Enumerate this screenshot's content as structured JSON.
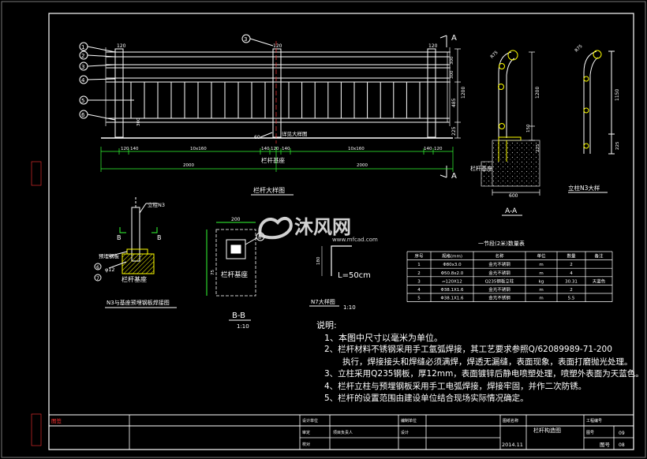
{
  "balloons": [
    "1",
    "2",
    "3",
    "4",
    "5",
    "6"
  ],
  "elevation": {
    "title": "栏杆大样图",
    "section_mark": "A",
    "see_detail_text": "详见大样图",
    "base_text": "栏杆基座",
    "post_top": "120",
    "dim_top_row": [
      "120",
      "140",
      "10x160",
      "140",
      "120",
      "140",
      "10x160",
      "140",
      "120"
    ],
    "dim_bottom": [
      "2000",
      "2000"
    ],
    "heights": [
      "1200",
      "485",
      "225",
      "60",
      "300",
      "300",
      "300"
    ]
  },
  "section_aa": {
    "title": "A-A",
    "base_label": "栏杆基座",
    "width": "600",
    "radius_label": "R75",
    "heights": [
      "1200",
      "150",
      "225"
    ]
  },
  "post_detail": {
    "title": "立柱N3大样",
    "radius_label": "R75",
    "heights": [
      "1150",
      "225"
    ]
  },
  "embed_detail": {
    "title": "N3与基座预埋钢板焊接图",
    "post_label": "立柱N3",
    "plate_label": "预埋钢板",
    "bolt_label": "φ12",
    "base_label": "栏杆基座",
    "marks": [
      "B",
      "B",
      "6",
      "7"
    ]
  },
  "section_bb": {
    "title": "B-B",
    "scale": "1:10",
    "label": "栏杆基座",
    "dims": [
      "200",
      "75",
      "25",
      "70",
      "75"
    ],
    "balloon": "8"
  },
  "n7_detail": {
    "title": "N7大样图",
    "scale": "1:10",
    "length_label": "L=50cm",
    "dims": [
      "180",
      "100"
    ]
  },
  "table": {
    "title": "一节段(2米)数量表",
    "headers": [
      "序号",
      "规格(mm)",
      "名称",
      "单位",
      "数量",
      "备注"
    ],
    "rows": [
      [
        "1",
        "Φ80x3.0",
        "金光不锈钢",
        "m",
        "2",
        ""
      ],
      [
        "2",
        "Φ50.8x2.0",
        "金光不锈钢",
        "m",
        "4",
        ""
      ],
      [
        "3",
        "▱120X12",
        "Q235钢板立柱",
        "kg",
        "30.31",
        "天蓝色"
      ],
      [
        "4",
        "Φ38.1X1.6",
        "金光不锈钢",
        "m",
        "2",
        ""
      ],
      [
        "5",
        "Φ38.1X1.6",
        "金光不锈钢",
        "m",
        "5.5",
        ""
      ]
    ]
  },
  "watermark": {
    "brand": "沐风网",
    "url": "www.mfcad.com"
  },
  "notes": {
    "heading": "说明:",
    "lines": [
      "1、本图中尺寸以毫米为单位。",
      "2、栏杆材料不锈钢采用手工氩弧焊接，其工艺要求参照Q/62089989-71-200",
      "执行，焊接接头和焊缝必须满焊，焊透无漏缝，表面现象，表面打磨抛光处理。",
      "3、立柱采用Q235钢板，厚12mm，表面镀锌后静电喷塑处理，喷塑外表面为天蓝色。",
      "4、栏杆立柱与预埋钢板采用手工电弧焊接，焊接牢固，并作二次防锈。",
      "5、栏杆的设置范围由建设单位结合现场实际情况确定。"
    ]
  },
  "title_block": {
    "left_label": "图签",
    "cells": [
      "设计单位",
      "编制单位",
      "图纸名称",
      "工程编号",
      "审定",
      "项目负责人",
      "校对",
      "设计",
      "图号"
    ],
    "drawing_title": "栏杆构造图",
    "date": "2014.11",
    "sheet_label": "图号",
    "sheet_no": "09",
    "sheet_total": "08"
  },
  "colors": {
    "background": "#000000",
    "line": "#ffffff",
    "dim": "#33ff33",
    "hatch": "#ffff00",
    "cyan": "#00ffff",
    "magenta": "#ff00ff",
    "watermark": "#e8e8e8"
  }
}
